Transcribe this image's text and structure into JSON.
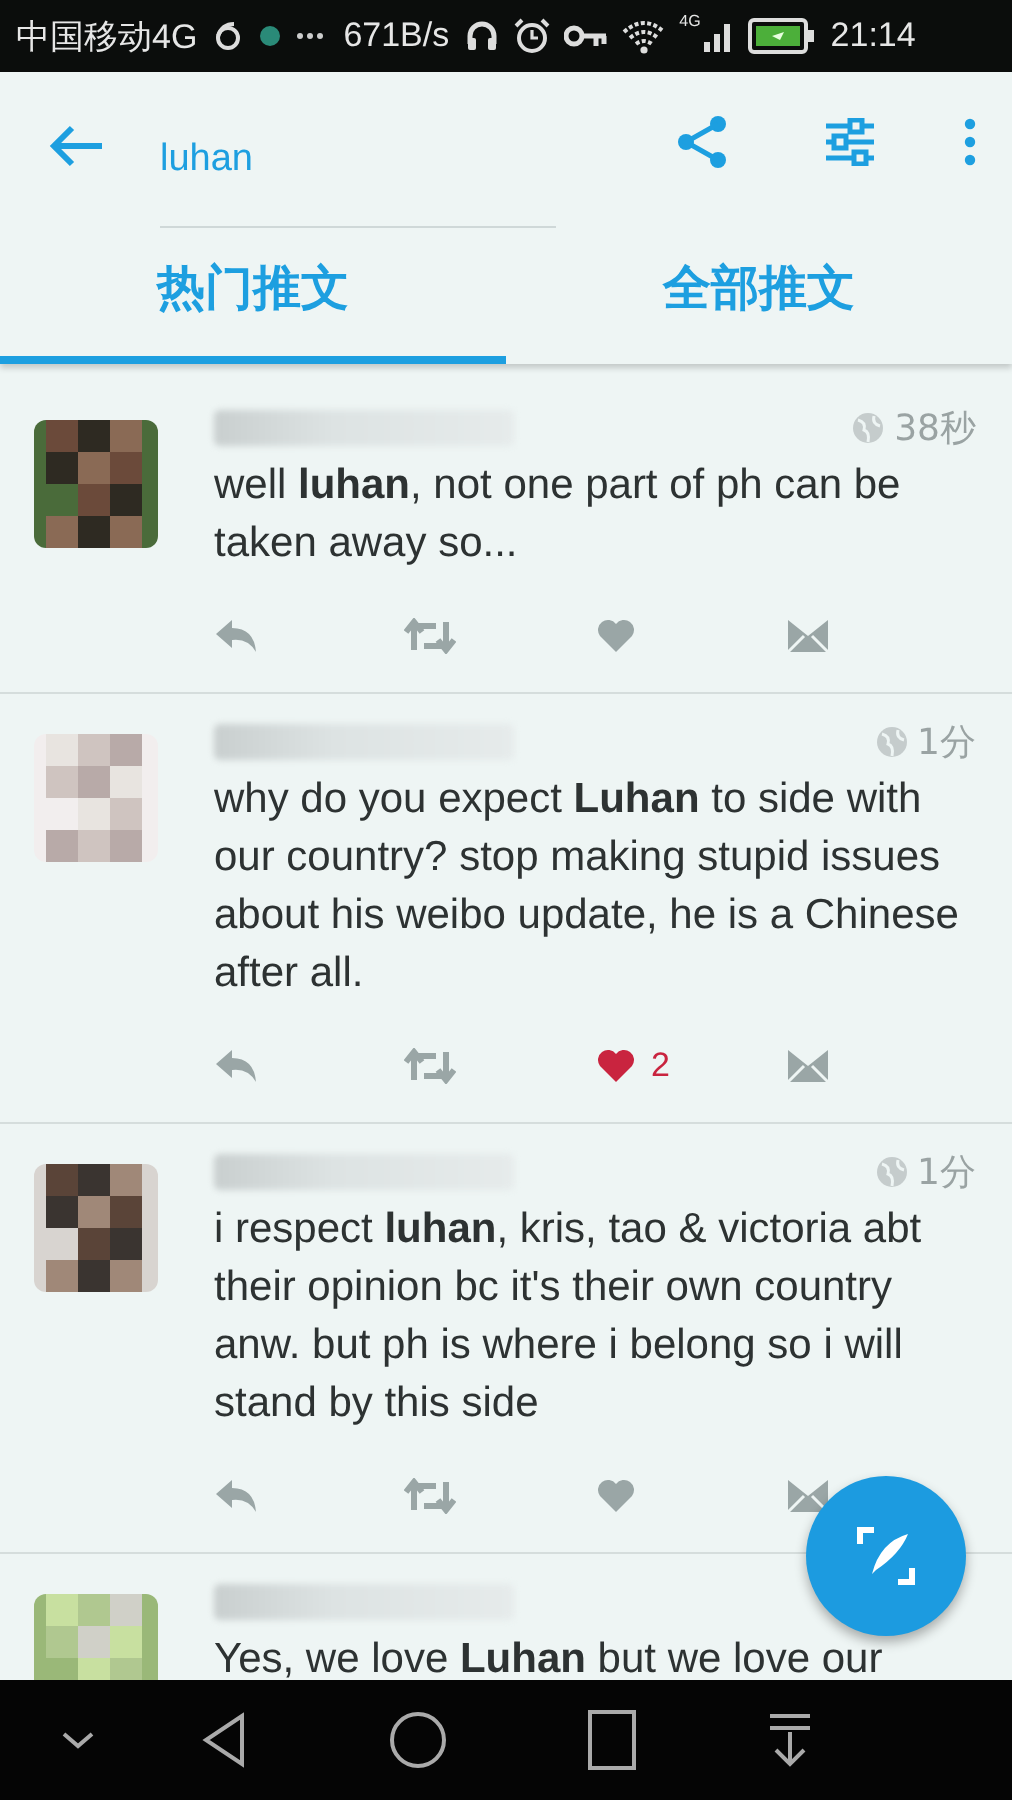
{
  "status_bar": {
    "carrier": "中国移动4G",
    "speed": "671B/s",
    "network": "4G",
    "time": "21:14"
  },
  "search": {
    "value": "luhan"
  },
  "tabs": [
    {
      "label": "热门推文",
      "selected": true
    },
    {
      "label": "全部推文",
      "selected": false
    }
  ],
  "tweets": [
    {
      "time": "38秒",
      "text": "well **luhan**, not one part of ph can be taken away so...",
      "liked": false
    },
    {
      "time": "1分",
      "text": "why do you expect **Luhan** to side with our country? stop making stupid issues about his weibo update, he is a Chinese after all.",
      "liked": true,
      "likes": "2"
    },
    {
      "time": "1分",
      "text": "i respect **luhan**, kris, tao & victoria abt their opinion bc it's their own country anw. but ph is where i belong so i will stand by this side",
      "liked": false
    },
    {
      "text": "Yes, we love **Luhan** but we love our"
    }
  ]
}
